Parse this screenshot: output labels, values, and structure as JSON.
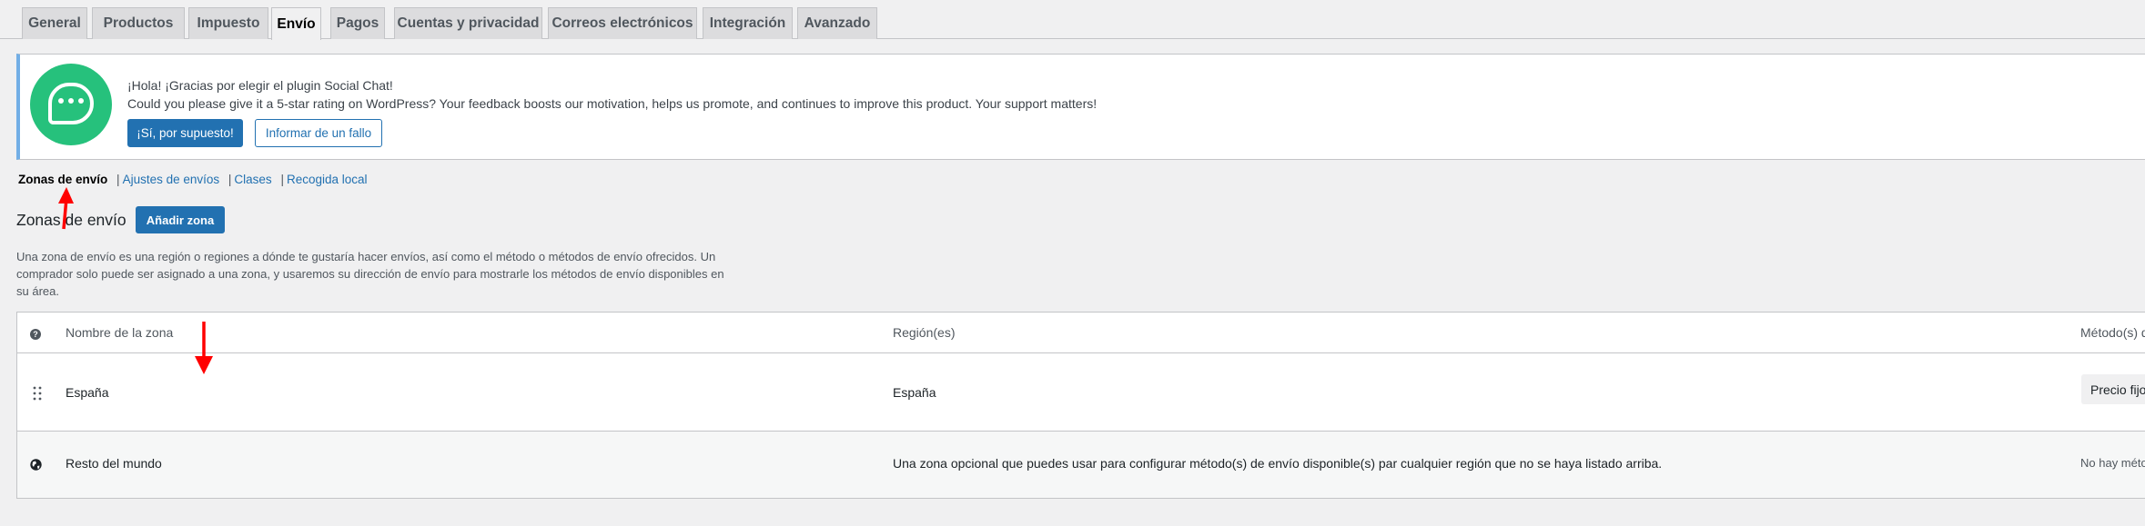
{
  "tabs": [
    {
      "label": "General"
    },
    {
      "label": "Productos"
    },
    {
      "label": "Impuesto"
    },
    {
      "label": "Envío",
      "active": true
    },
    {
      "label": "Pagos"
    },
    {
      "label": "Cuentas y privacidad"
    },
    {
      "label": "Correos electrónicos"
    },
    {
      "label": "Integración"
    },
    {
      "label": "Avanzado"
    }
  ],
  "notice": {
    "line1": "¡Hola! ¡Gracias por elegir el plugin Social Chat!",
    "line2": "Could you please give it a 5-star rating on WordPress? Your feedback boosts our motivation, helps us promote, and continues to improve this product. Your support matters!",
    "yes_button": "¡Sí, por supuesto!",
    "report_button": "Informar de un fallo",
    "logo_icon": "chat-bubble-icon",
    "logo_color": "#26c17c"
  },
  "subnav": {
    "current": "Zonas de envío",
    "links": [
      "Ajustes de envíos",
      "Clases",
      "Recogida local"
    ],
    "separator": "|"
  },
  "page": {
    "title": "Zonas de envío",
    "add_button": "Añadir zona",
    "description": "Una zona de envío es una región o regiones a dónde te gustaría hacer envíos, así como el método o métodos de envío ofrecidos. Un comprador solo puede ser asignado a una zona, y usaremos su dirección de envío para mostrarle los métodos de envío disponibles en su área."
  },
  "table": {
    "columns": [
      "Nombre de la zona",
      "Región(es)",
      "Método(s) d"
    ],
    "help_icon": "help-icon",
    "rows": [
      {
        "name": "España",
        "region": "España",
        "methods": "Precio fijo",
        "icon": "drag-handle-icon"
      },
      {
        "name": "Resto del mundo",
        "region": "Una zona opcional que puedes usar para configurar método(s) de envío disponible(s) par cualquier región que no se haya listado arriba.",
        "methods": "No hay métod",
        "icon": "globe-icon"
      }
    ]
  },
  "colors": {
    "accent": "#2271b1",
    "annotation_arrow": "#ff0000"
  }
}
